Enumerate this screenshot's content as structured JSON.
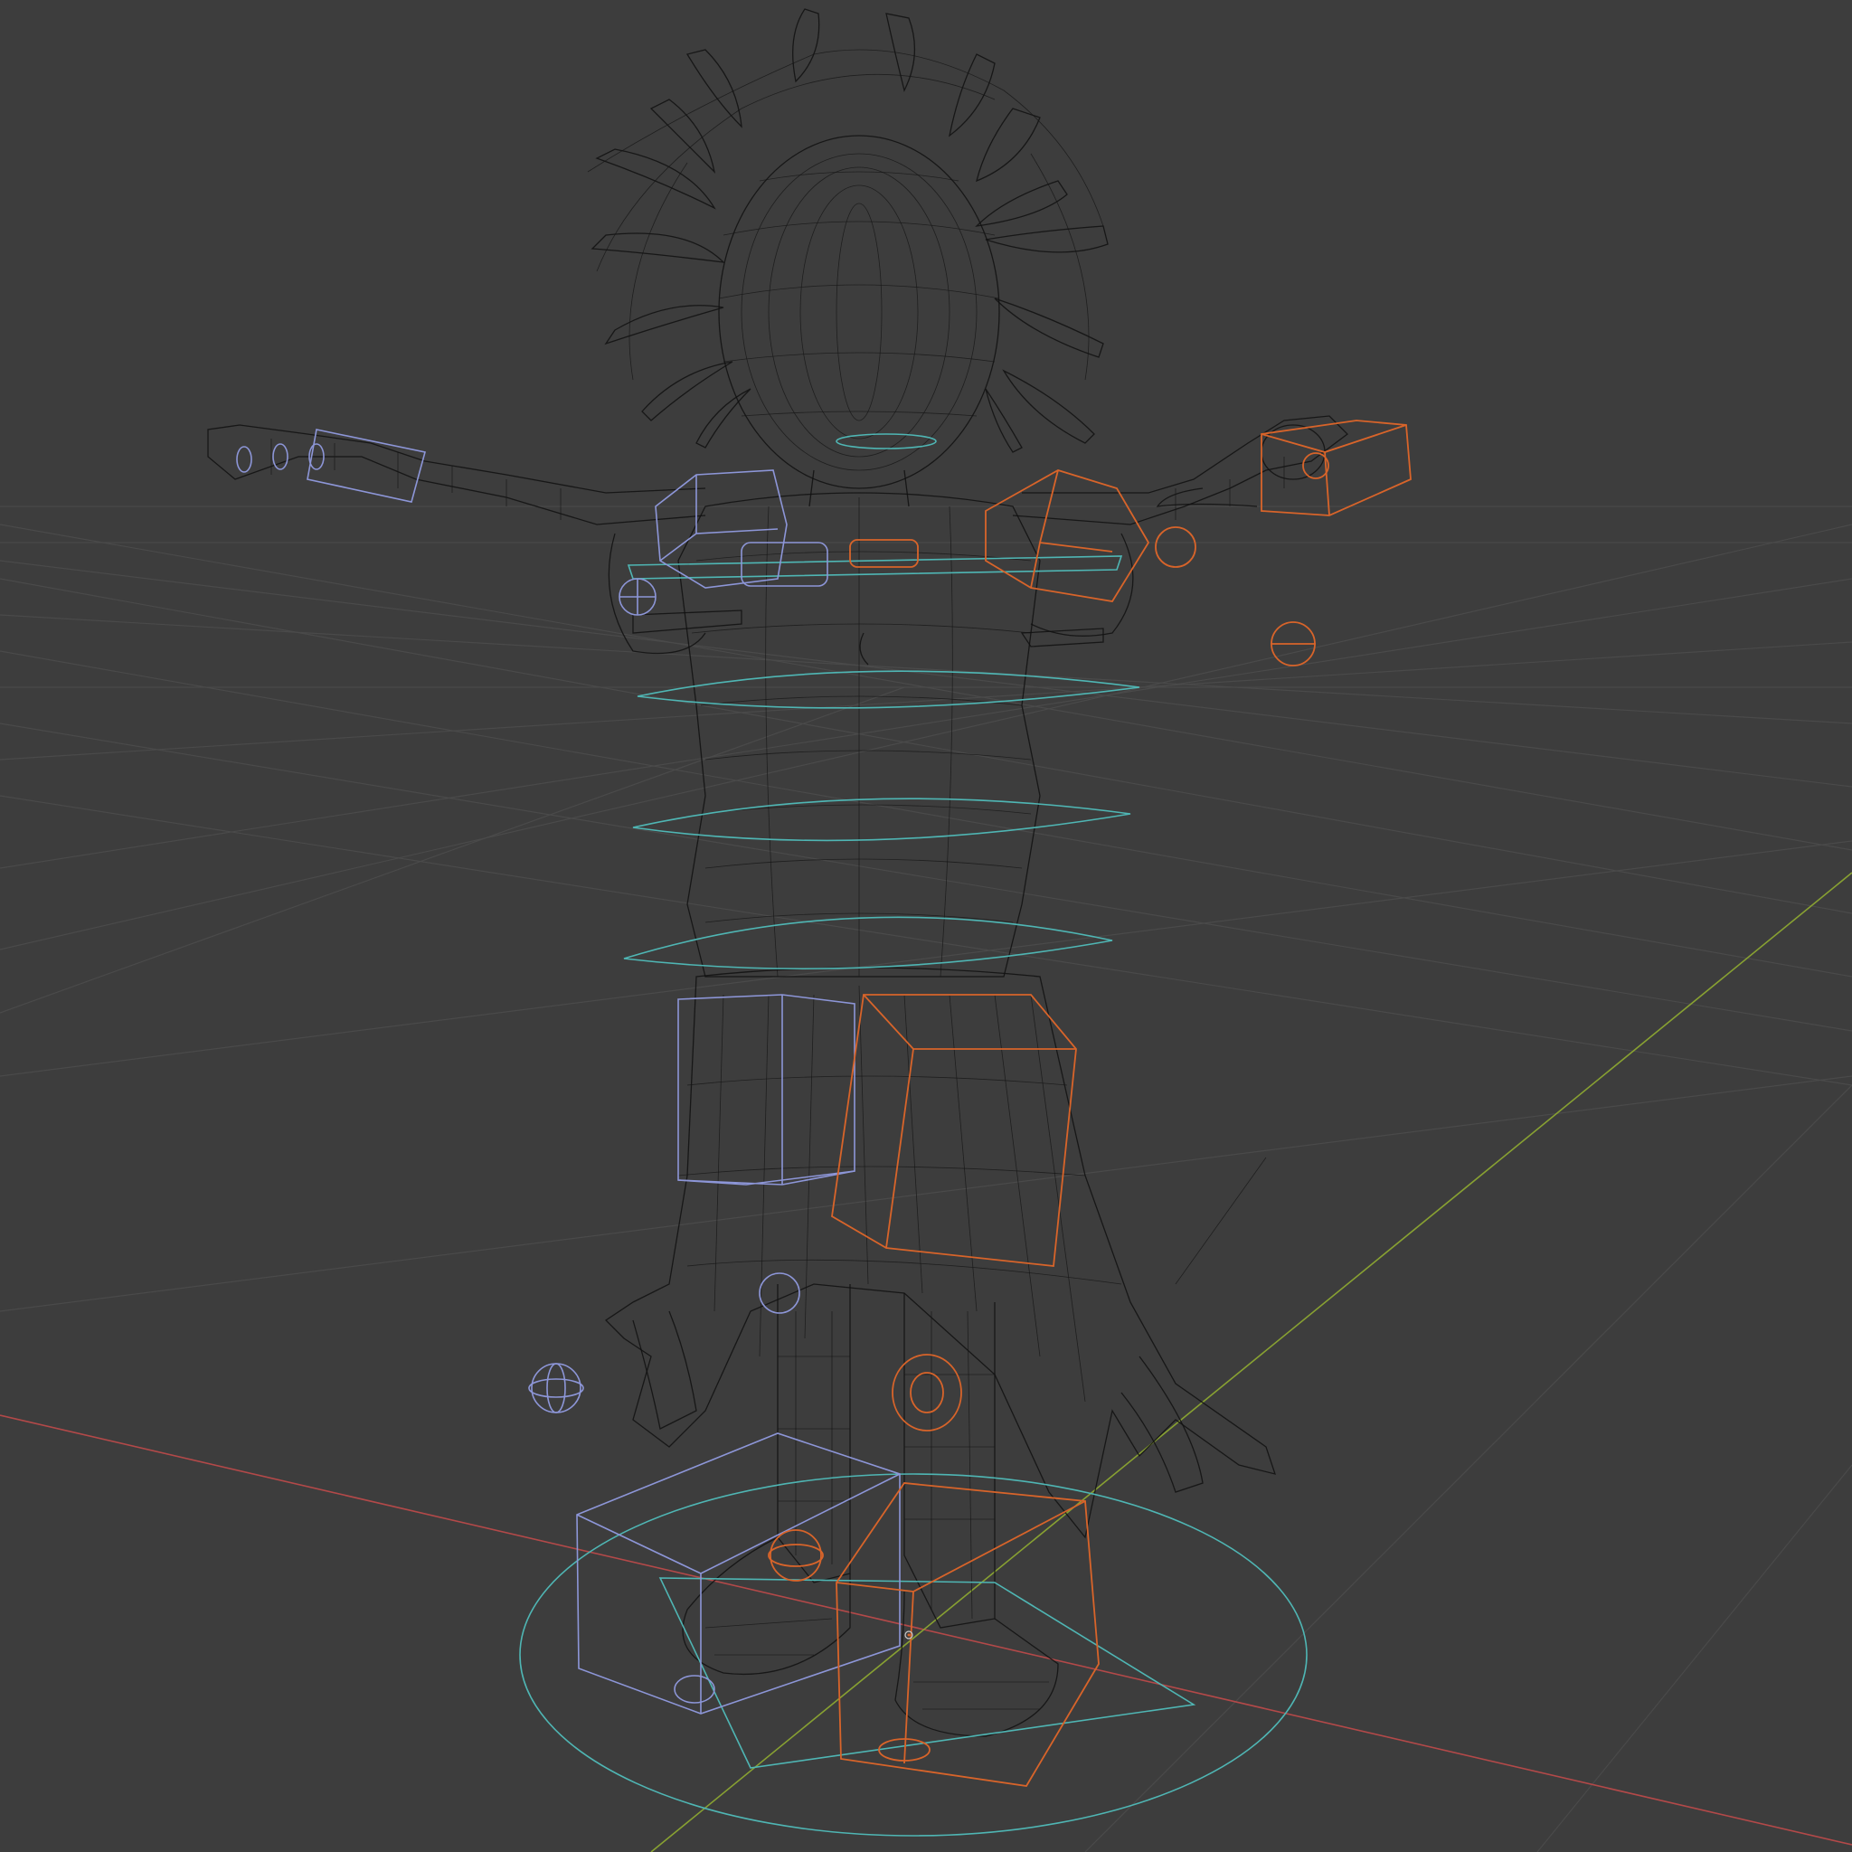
{
  "viewport": {
    "background": "#3d3d3d",
    "grid_color": "#4a4a4a",
    "axis_x_color": "#b34949",
    "axis_y_color": "#88a132",
    "shading": "wireframe"
  },
  "character": {
    "wire_color": "#111111"
  },
  "rig_controls": {
    "center_color": "#4fb6b4",
    "left_color": "#8d96d8",
    "right_color": "#d8642a"
  }
}
